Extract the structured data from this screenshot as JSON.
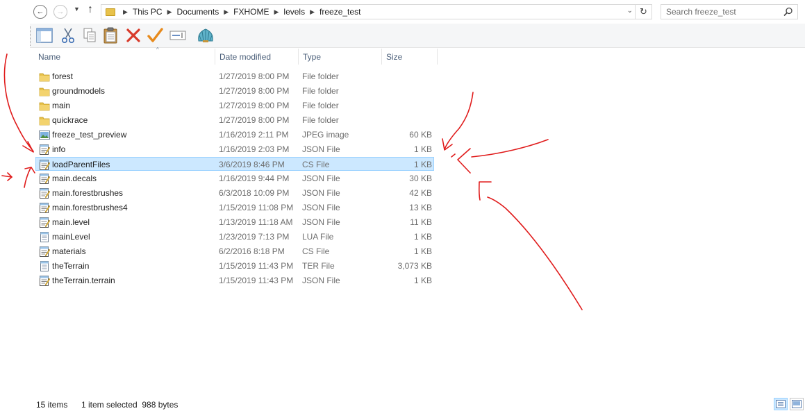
{
  "navigation": {
    "back_icon": "arrow-left-icon",
    "forward_icon": "arrow-right-icon",
    "recent_icon": "chevron-down-icon",
    "up_icon": "arrow-up-icon"
  },
  "address": {
    "crumbs": [
      "This PC",
      "Documents",
      "FXHOME",
      "levels",
      "freeze_test"
    ]
  },
  "search": {
    "placeholder": "Search freeze_test"
  },
  "toolbar": {
    "icons": [
      "preview-pane-icon",
      "cut-icon",
      "copy-icon",
      "paste-icon",
      "delete-icon",
      "checkmark-icon",
      "rename-icon",
      "shell-icon"
    ]
  },
  "columns": {
    "name": "Name",
    "date": "Date modified",
    "type": "Type",
    "size": "Size"
  },
  "files": [
    {
      "name": "forest",
      "date": "1/27/2019 8:00 PM",
      "type": "File folder",
      "size": "",
      "icon": "folder"
    },
    {
      "name": "groundmodels",
      "date": "1/27/2019 8:00 PM",
      "type": "File folder",
      "size": "",
      "icon": "folder"
    },
    {
      "name": "main",
      "date": "1/27/2019 8:00 PM",
      "type": "File folder",
      "size": "",
      "icon": "folder"
    },
    {
      "name": "quickrace",
      "date": "1/27/2019 8:00 PM",
      "type": "File folder",
      "size": "",
      "icon": "folder"
    },
    {
      "name": "freeze_test_preview",
      "date": "1/16/2019 2:11 PM",
      "type": "JPEG image",
      "size": "60 KB",
      "icon": "image"
    },
    {
      "name": "info",
      "date": "1/16/2019 2:03 PM",
      "type": "JSON File",
      "size": "1 KB",
      "icon": "notepad"
    },
    {
      "name": "loadParentFiles",
      "date": "3/6/2019 8:46 PM",
      "type": "CS File",
      "size": "1 KB",
      "icon": "notepad",
      "selected": true
    },
    {
      "name": "main.decals",
      "date": "1/16/2019 9:44 PM",
      "type": "JSON File",
      "size": "30 KB",
      "icon": "notepad"
    },
    {
      "name": "main.forestbrushes",
      "date": "6/3/2018 10:09 PM",
      "type": "JSON File",
      "size": "42 KB",
      "icon": "notepad"
    },
    {
      "name": "main.forestbrushes4",
      "date": "1/15/2019 11:08 PM",
      "type": "JSON File",
      "size": "13 KB",
      "icon": "notepad"
    },
    {
      "name": "main.level",
      "date": "1/13/2019 11:18 AM",
      "type": "JSON File",
      "size": "11 KB",
      "icon": "notepad"
    },
    {
      "name": "mainLevel",
      "date": "1/23/2019 7:13 PM",
      "type": "LUA File",
      "size": "1 KB",
      "icon": "document"
    },
    {
      "name": "materials",
      "date": "6/2/2016 8:18 PM",
      "type": "CS File",
      "size": "1 KB",
      "icon": "notepad"
    },
    {
      "name": "theTerrain",
      "date": "1/15/2019 11:43 PM",
      "type": "TER File",
      "size": "3,073 KB",
      "icon": "document"
    },
    {
      "name": "theTerrain.terrain",
      "date": "1/15/2019 11:43 PM",
      "type": "JSON File",
      "size": "1 KB",
      "icon": "notepad"
    }
  ],
  "status": {
    "count": "15 items",
    "selection": "1 item selected  988 bytes"
  },
  "colors": {
    "selection_bg": "#cce8ff",
    "selection_border": "#99d1ff",
    "annotation": "#e01b1b",
    "folder": "#e8c24b"
  }
}
